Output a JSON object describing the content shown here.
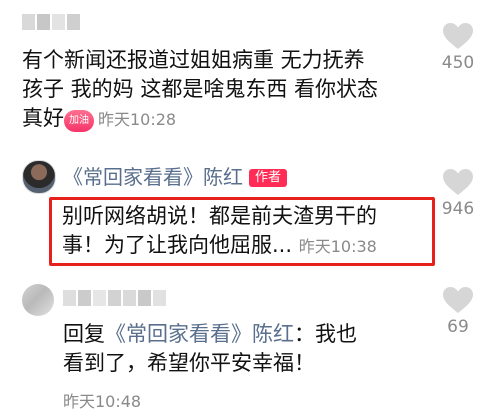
{
  "comments": [
    {
      "lines": [
        "有个新闻还报道过姐姐病重 无力抚养",
        "孩子 我的妈 这都是啥鬼东西 看你状态"
      ],
      "last_line": "真好",
      "emoji_text": "加油",
      "time": "昨天10:28",
      "likes": "450"
    },
    {
      "author": "《常回家看看》陈红",
      "author_badge": "作者",
      "lines": [
        "别听网络胡说！都是前夫渣男干的",
        "事！为了让我向他屈服..."
      ],
      "time": "昨天10:38",
      "likes": "946"
    },
    {
      "reply_prefix": "回复",
      "reply_to": "《常回家看看》陈红",
      "reply_colon": "：",
      "text_first": "我也",
      "line2": "看到了，希望你平安幸福！",
      "time": "昨天10:48",
      "likes": "69"
    }
  ],
  "colors": {
    "highlight_border": "#e6211c",
    "author_badge_bg": "#ff2d55",
    "nickname": "#5a6f8e",
    "meta": "#8a8a8a"
  }
}
